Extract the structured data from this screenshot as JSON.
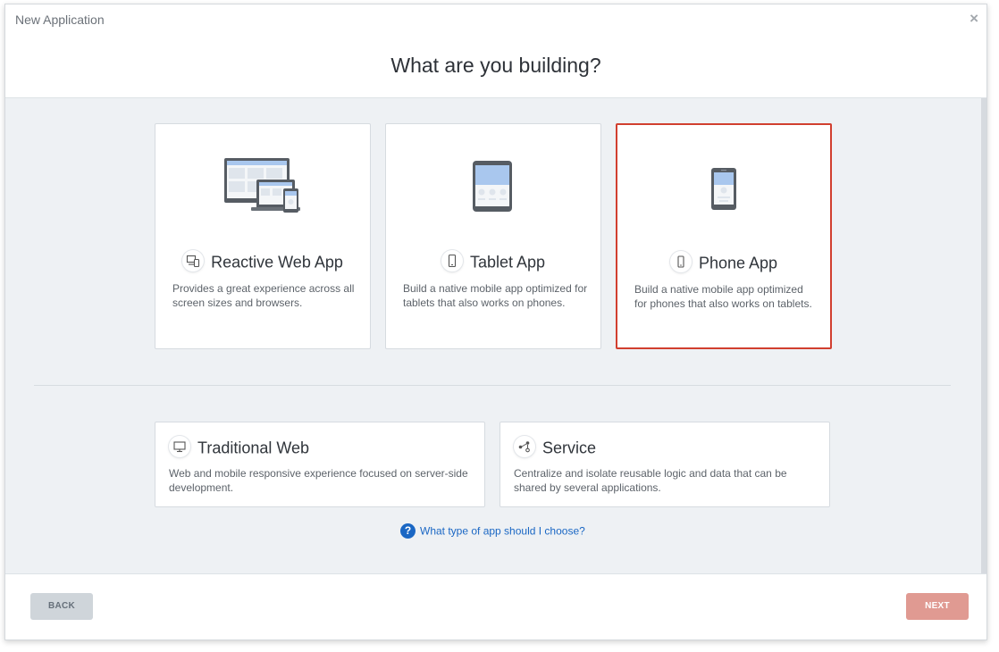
{
  "window": {
    "title": "New Application",
    "close_icon": "×"
  },
  "heading": "What are you building?",
  "cards": [
    {
      "title": "Reactive Web App",
      "desc": "Provides a great experience across all screen sizes and browsers.",
      "icon": "devices-icon",
      "selected": false
    },
    {
      "title": "Tablet App",
      "desc": "Build a native mobile app optimized for tablets that also works on phones.",
      "icon": "tablet-icon",
      "selected": false
    },
    {
      "title": "Phone App",
      "desc": "Build a native mobile app optimized for phones that also works on tablets.",
      "icon": "phone-icon",
      "selected": true
    }
  ],
  "secondary_cards": [
    {
      "title": "Traditional Web",
      "desc": "Web and mobile responsive experience focused on server-side development.",
      "icon": "monitor-icon"
    },
    {
      "title": "Service",
      "desc": "Centralize and isolate reusable logic and data that can be shared by several applications.",
      "icon": "service-icon"
    }
  ],
  "help": {
    "icon": "?",
    "text": "What type of app should I choose?"
  },
  "footer": {
    "back_label": "BACK",
    "next_label": "NEXT"
  },
  "colors": {
    "accent": "#d13f2f",
    "link": "#1a67c4",
    "next_button": "#e09a92",
    "back_button": "#cfd5da",
    "content_bg": "#eef1f4"
  }
}
